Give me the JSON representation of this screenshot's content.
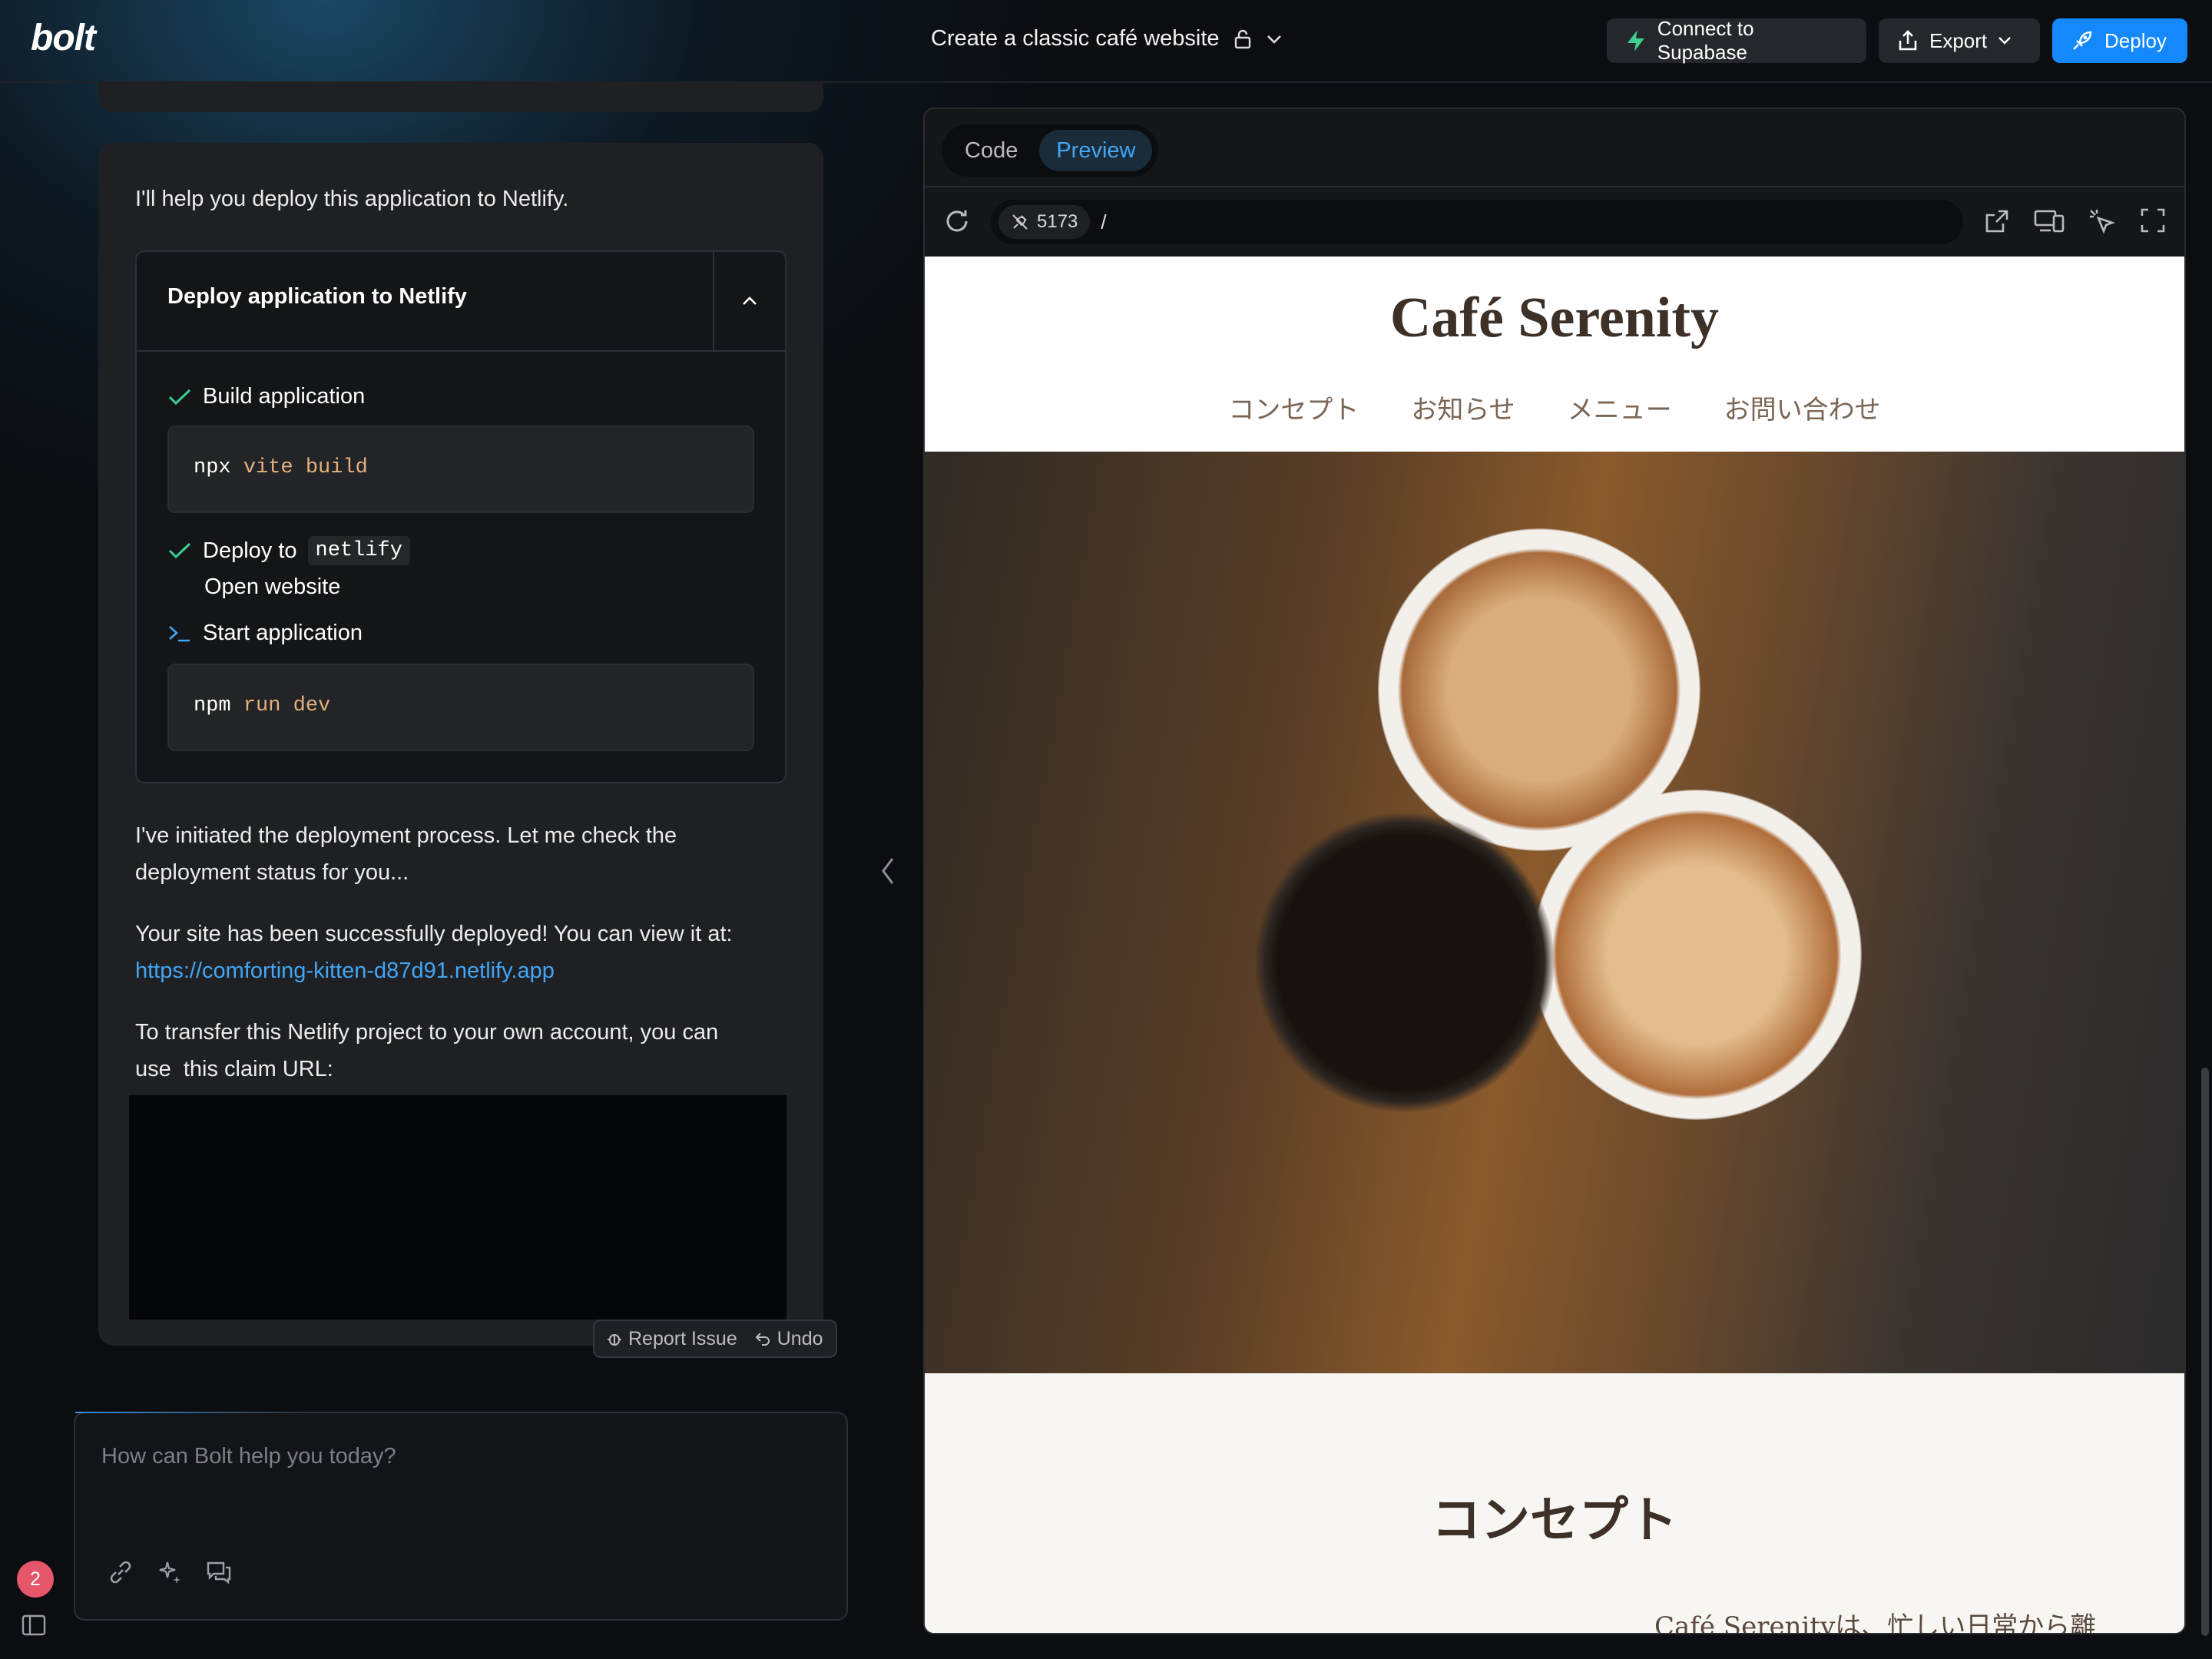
{
  "header": {
    "logo": "bolt",
    "project_title": "Create a classic café website",
    "supabase_label": "Connect to Supabase",
    "export_label": "Export",
    "deploy_label": "Deploy"
  },
  "chat": {
    "intro": "I'll help you deploy this application to Netlify.",
    "action": {
      "title": "Deploy application to Netlify",
      "step1": "Build application",
      "code1_cmd": "npx",
      "code1_args": "vite build",
      "step2_prefix": "Deploy to",
      "step2_code": "netlify",
      "open_website": "Open website",
      "step3": "Start application",
      "code2_cmd": "npm",
      "code2_args": "run dev"
    },
    "msg_check_1": "I've initiated the deployment process. Let me check the",
    "msg_check_2": "deployment status for you...",
    "msg_success": "Your site has been successfully deployed! You can view it at:",
    "site_url": "https://comforting-kitten-d87d91.netlify.app",
    "msg_transfer_1": "To transfer this Netlify project to your own account, you can",
    "msg_transfer_2": "use  this claim URL:",
    "report_issue": "Report Issue",
    "undo": "Undo"
  },
  "input": {
    "placeholder": "How can Bolt help you today?"
  },
  "notifications": {
    "count": "2"
  },
  "preview": {
    "tab_code": "Code",
    "tab_preview": "Preview",
    "port": "5173",
    "path": "/"
  },
  "site": {
    "title": "Café Serenity",
    "nav": [
      "コンセプト",
      "お知らせ",
      "メニュー",
      "お問い合わせ"
    ],
    "concept_title": "コンセプト",
    "concept_text": "Café Serenityは、忙しい日常から離"
  },
  "colors": {
    "accent": "#1389fd",
    "link": "#41a6f5",
    "supabase_green": "#3ecf8e",
    "check_green": "#3ecf8e",
    "badge": "#e5566a"
  }
}
